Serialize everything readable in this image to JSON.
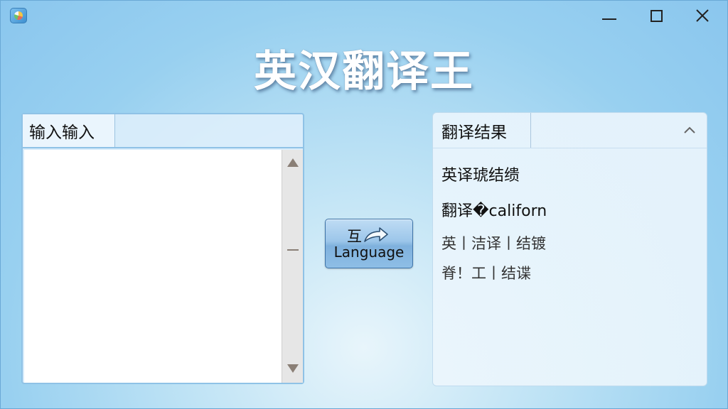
{
  "window": {
    "title": "英汉翻译王",
    "icon": "app-icon"
  },
  "left_panel": {
    "tab_label": "输入输入",
    "input_value": "",
    "scrollbar": true
  },
  "swap_button": {
    "line1": "互",
    "line2": "Language",
    "icon": "curved-arrow-right-icon"
  },
  "right_panel": {
    "tab_label": "翻译结果",
    "collapse_icon": "chevron-up-icon",
    "results": [
      "英译琥结缋",
      "翻译�californ",
      "英⼁洁译⼁结镀",
      "脊！工⼁结谍"
    ]
  },
  "colors": {
    "background": "#98d0f0",
    "title_text": "#ffffff",
    "button_blue": "#8ebee6",
    "panel_border": "#8fc2e6"
  }
}
